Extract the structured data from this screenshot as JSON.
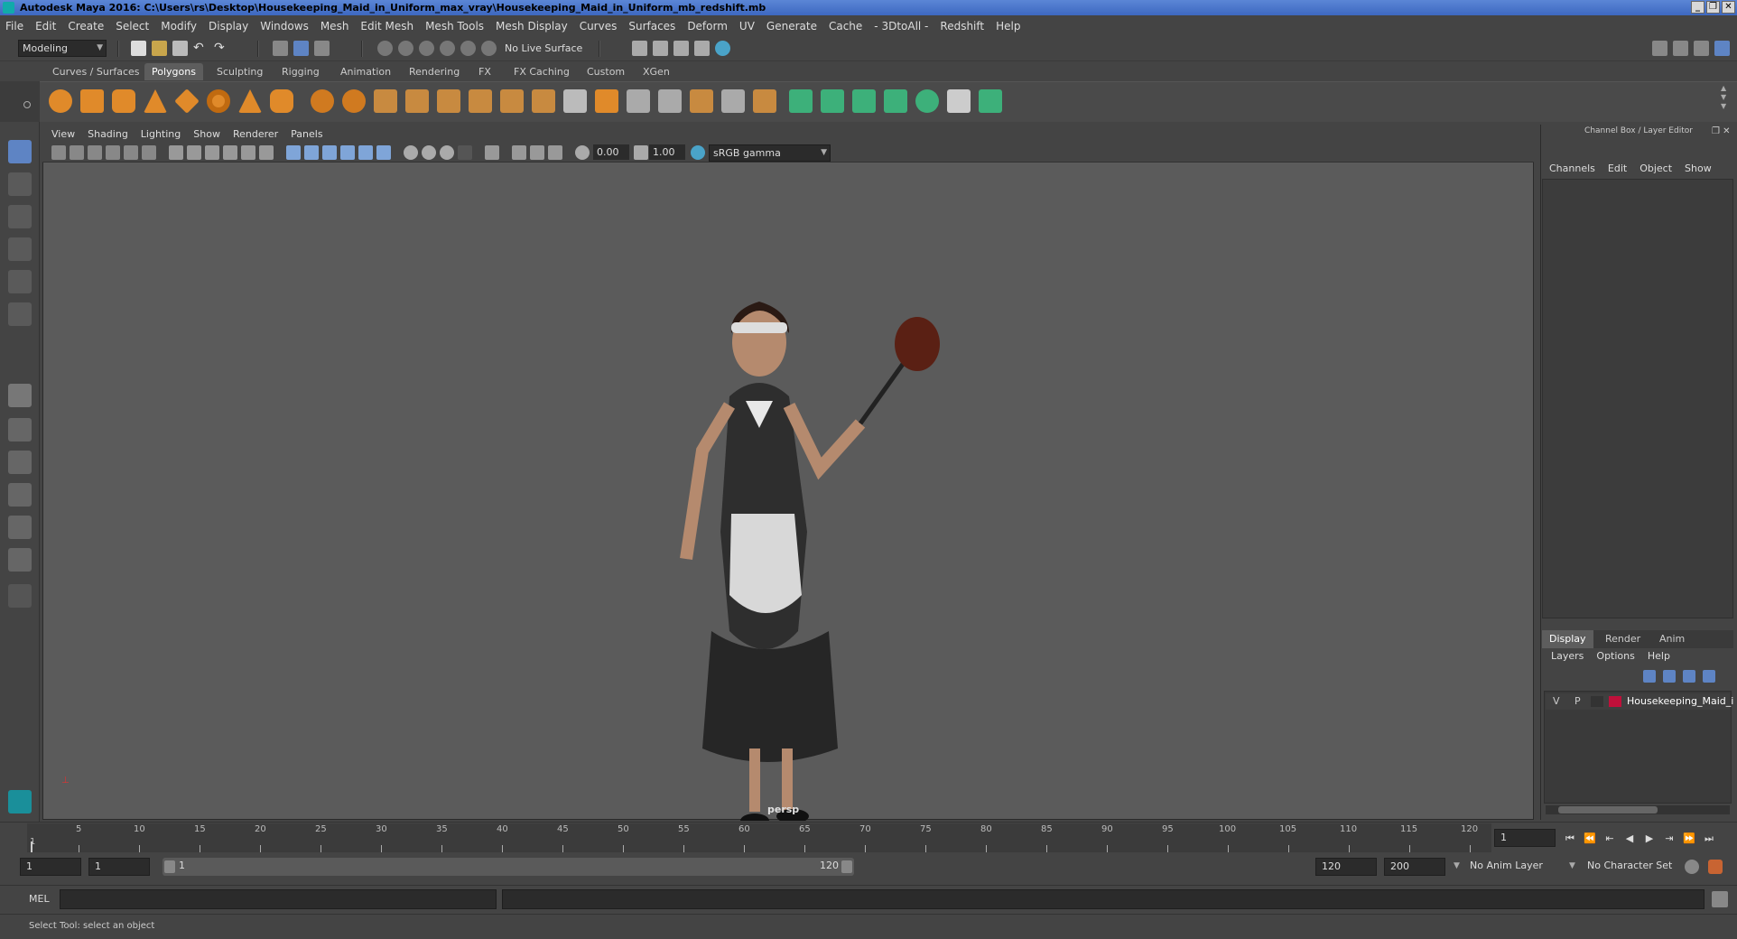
{
  "window": {
    "title": "Autodesk Maya 2016: C:\\Users\\rs\\Desktop\\Housekeeping_Maid_in_Uniform_max_vray\\Housekeeping_Maid_in_Uniform_mb_redshift.mb",
    "buttons": [
      "_",
      "❐",
      "✕"
    ]
  },
  "menubar": [
    "File",
    "Edit",
    "Create",
    "Select",
    "Modify",
    "Display",
    "Windows",
    "Mesh",
    "Edit Mesh",
    "Mesh Tools",
    "Mesh Display",
    "Curves",
    "Surfaces",
    "Deform",
    "UV",
    "Generate",
    "Cache",
    "- 3DtoAll -",
    "Redshift",
    "Help"
  ],
  "toolbar": {
    "mode": "Modeling",
    "live_surface": "No Live Surface"
  },
  "shelf_tabs": [
    "Curves / Surfaces",
    "Polygons",
    "Sculpting",
    "Rigging",
    "Animation",
    "Rendering",
    "FX",
    "FX Caching",
    "Custom",
    "XGen"
  ],
  "shelf_active": "Polygons",
  "viewport": {
    "menu": [
      "View",
      "Shading",
      "Lighting",
      "Show",
      "Renderer",
      "Panels"
    ],
    "exposure": "0.00",
    "gamma": "1.00",
    "color_space": "sRGB gamma",
    "camera_label": "persp"
  },
  "channel_box": {
    "title": "Channel Box / Layer Editor",
    "menu": [
      "Channels",
      "Edit",
      "Object",
      "Show"
    ]
  },
  "layer_editor": {
    "tabs": [
      "Display",
      "Render",
      "Anim"
    ],
    "active_tab": "Display",
    "menu": [
      "Layers",
      "Options",
      "Help"
    ],
    "layer": {
      "v": "V",
      "p": "P",
      "name": "Housekeeping_Maid_i",
      "color": "#c0103a"
    }
  },
  "timeline": {
    "ticks": [
      "5",
      "10",
      "15",
      "20",
      "25",
      "30",
      "35",
      "40",
      "45",
      "50",
      "55",
      "60",
      "65",
      "70",
      "75",
      "80",
      "85",
      "90",
      "95",
      "100",
      "105",
      "110",
      "115",
      "120"
    ],
    "start_tick": "1",
    "current_frame": "1"
  },
  "range": {
    "start": "1",
    "playback_start": "1",
    "slider_start": "1",
    "slider_end": "120",
    "end": "120",
    "anim_end": "200",
    "anim_layer": "No Anim Layer",
    "char_set": "No Character Set"
  },
  "command_line": {
    "label": "MEL"
  },
  "status": "Select Tool: select an object",
  "colors": {
    "accent_blue": "#5b86d6",
    "shelf_orange": "#e08a2a",
    "shelf_green": "#3db07a"
  }
}
